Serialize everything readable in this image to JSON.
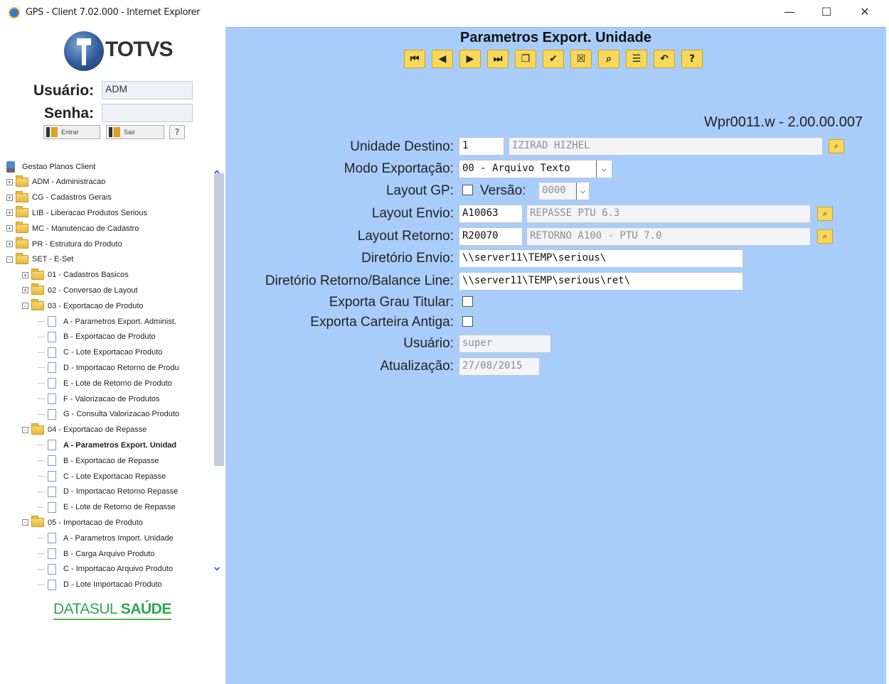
{
  "window": {
    "title": "GPS - Client 7.02.000 - Internet Explorer",
    "controls": [
      "—",
      "☐",
      "✕"
    ]
  },
  "login": {
    "logo_text": "TOTVS",
    "user_label": "Usuário:",
    "user_value": "ADM",
    "password_label": "Senha:",
    "password_value": "",
    "enter_button": "Entrar",
    "exit_button": "Sair",
    "help_button": "?"
  },
  "tree": {
    "items": [
      {
        "label": "Gestao Planos Client",
        "level": 0,
        "type": "root"
      },
      {
        "label": "ADM - Administracao",
        "level": 0,
        "type": "folder",
        "exp": "+"
      },
      {
        "label": "CG - Cadastros Gerais",
        "level": 0,
        "type": "folder",
        "exp": "+"
      },
      {
        "label": "LIB - Liberacao Produtos Serious",
        "level": 0,
        "type": "folder",
        "exp": "+"
      },
      {
        "label": "MC - Manutencao de Cadastro",
        "level": 0,
        "type": "folder",
        "exp": "+"
      },
      {
        "label": "PR - Estrutura do Produto",
        "level": 0,
        "type": "folder",
        "exp": "+"
      },
      {
        "label": "SET - E-Set",
        "level": 0,
        "type": "folder",
        "exp": "-"
      },
      {
        "label": "01 - Cadastros Basicos",
        "level": 1,
        "type": "folder",
        "exp": "+"
      },
      {
        "label": "02 - Conversao de Layout",
        "level": 1,
        "type": "folder",
        "exp": "+"
      },
      {
        "label": "03 - Exportacao de Produto",
        "level": 1,
        "type": "folder",
        "exp": "-"
      },
      {
        "label": "A - Parametros Export. Administ.",
        "level": 2,
        "type": "doc"
      },
      {
        "label": "B - Exportacao de Produto",
        "level": 2,
        "type": "doc"
      },
      {
        "label": "C - Lote Exportacao Produto",
        "level": 2,
        "type": "doc"
      },
      {
        "label": "D - Importacao Retorno de Produ",
        "level": 2,
        "type": "doc"
      },
      {
        "label": "E - Lote de Retorno de Produto",
        "level": 2,
        "type": "doc"
      },
      {
        "label": "F - Valorizacao de Produtos",
        "level": 2,
        "type": "doc"
      },
      {
        "label": "G - Consulta Valorizacao Produto",
        "level": 2,
        "type": "doc"
      },
      {
        "label": "04 - Exportacao de Repasse",
        "level": 1,
        "type": "folder",
        "exp": "-"
      },
      {
        "label": "A - Parametros Export. Unidad",
        "level": 2,
        "type": "doc",
        "bold": true
      },
      {
        "label": "B - Exportacao de Repasse",
        "level": 2,
        "type": "doc"
      },
      {
        "label": "C - Lote Exportacao Repasse",
        "level": 2,
        "type": "doc"
      },
      {
        "label": "D - Importacao Retorno Repasse",
        "level": 2,
        "type": "doc"
      },
      {
        "label": "E - Lote de Retorno de Repasse",
        "level": 2,
        "type": "doc"
      },
      {
        "label": "05 - Importacao de Produto",
        "level": 1,
        "type": "folder",
        "exp": "-"
      },
      {
        "label": "A - Parametros Import. Unidade",
        "level": 2,
        "type": "doc"
      },
      {
        "label": "B - Carga Arquivo Produto",
        "level": 2,
        "type": "doc"
      },
      {
        "label": "C - Importacao Arquivo Produto",
        "level": 2,
        "type": "doc"
      },
      {
        "label": "D - Lote Importacao Produto",
        "level": 2,
        "type": "doc"
      }
    ],
    "scroll_up": "⌃",
    "scroll_down": "⌄"
  },
  "footer_brand": {
    "part1": "DATASUL",
    "part2": "SAÚDE"
  },
  "main": {
    "title": "Parametros Export. Unidade",
    "toolbar": [
      {
        "name": "first-record-icon",
        "glyph": "⏮"
      },
      {
        "name": "previous-record-icon",
        "glyph": "◀"
      },
      {
        "name": "next-record-icon",
        "glyph": "▶"
      },
      {
        "name": "last-record-icon",
        "glyph": "⏭"
      },
      {
        "name": "new-record-icon",
        "glyph": "❐"
      },
      {
        "name": "confirm-icon",
        "glyph": "✔"
      },
      {
        "name": "delete-icon",
        "glyph": "☒"
      },
      {
        "name": "search-icon",
        "glyph": "⌕"
      },
      {
        "name": "report-icon",
        "glyph": "☰"
      },
      {
        "name": "undo-icon",
        "glyph": "↶"
      },
      {
        "name": "help-icon",
        "glyph": "?"
      }
    ],
    "program_version": "Wpr0011.w - 2.00.00.007",
    "fields": {
      "unidade_destino": {
        "label": "Unidade Destino:",
        "code": "1",
        "description": "IZIRAD HIZHEL"
      },
      "modo_exportacao": {
        "label": "Modo Exportação:",
        "value": "00 - Arquivo Texto"
      },
      "layout_gp": {
        "label": "Layout GP:",
        "versao_label": "Versão:",
        "versao_value": "0000"
      },
      "layout_envio": {
        "label": "Layout Envio:",
        "code": "A10063",
        "description": "REPASSE PTU 6.3"
      },
      "layout_retorno": {
        "label": "Layout Retorno:",
        "code": "R20070",
        "description": "RETORNO A100 - PTU 7.0"
      },
      "diretorio_envio": {
        "label": "Diretório Envio:",
        "value": "\\\\server11\\TEMP\\serious\\"
      },
      "diretorio_retorno": {
        "label": "Diretório Retorno/Balance Line:",
        "value": "\\\\server11\\TEMP\\serious\\ret\\"
      },
      "exporta_grau_titular": {
        "label": "Exporta Grau Titular:"
      },
      "exporta_carteira_antiga": {
        "label": "Exporta Carteira Antiga:"
      },
      "usuario": {
        "label": "Usuário:",
        "value": "super"
      },
      "atualizacao": {
        "label": "Atualização:",
        "value": "27/08/2015"
      }
    }
  }
}
